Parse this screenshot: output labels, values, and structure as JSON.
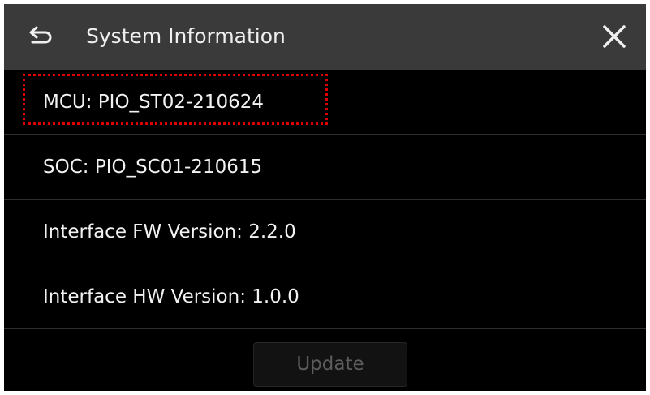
{
  "header": {
    "title": "System Information",
    "back_icon": "back-arrow-icon",
    "close_icon": "close-icon"
  },
  "info_rows": [
    {
      "label": "MCU: PIO_ST02-210624"
    },
    {
      "label": "SOC: PIO_SC01-210615"
    },
    {
      "label": "Interface FW Version: 2.2.0"
    },
    {
      "label": "Interface HW Version: 1.0.0"
    }
  ],
  "footer": {
    "update_label": "Update",
    "update_enabled": false
  },
  "colors": {
    "header_bg": "#3a3a3a",
    "screen_bg": "#000000",
    "text": "#f2f2f2",
    "highlight": "#e00000",
    "disabled_text": "#5c5c5c"
  }
}
